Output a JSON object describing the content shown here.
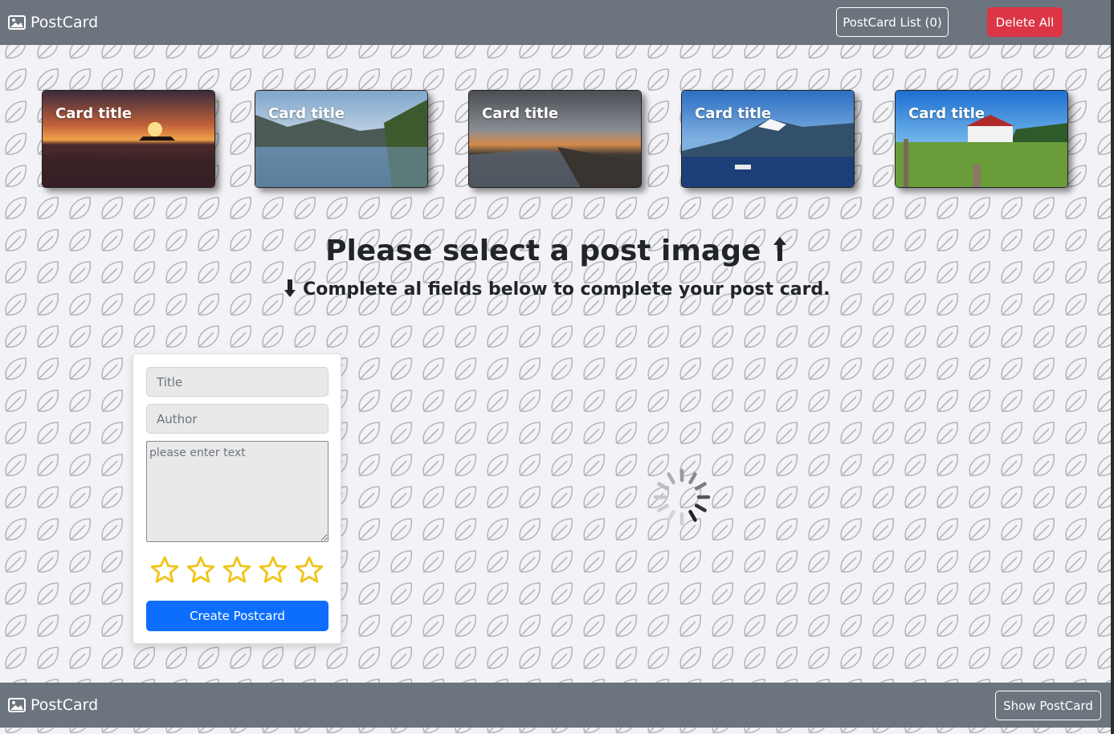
{
  "app": {
    "brand": "PostCard"
  },
  "header": {
    "list_button": "PostCard List (0)",
    "delete_button": "Delete All"
  },
  "cards": [
    {
      "title": "Card title",
      "scene": "sunset-sea"
    },
    {
      "title": "Card title",
      "scene": "fjord-reflection"
    },
    {
      "title": "Card title",
      "scene": "aerial-dusk"
    },
    {
      "title": "Card title",
      "scene": "snow-mountain-lake"
    },
    {
      "title": "Card title",
      "scene": "church-meadow"
    }
  ],
  "main": {
    "heading": "Please select a post image",
    "heading_icon": "arrow-up-icon",
    "subheading": "Complete al fields below to complete your post card.",
    "subheading_icon": "arrow-down-icon"
  },
  "form": {
    "title_placeholder": "Title",
    "author_placeholder": "Author",
    "text_placeholder": "please enter text",
    "rating": {
      "value": 0,
      "max": 5
    },
    "submit_label": "Create Postcard"
  },
  "footer": {
    "brand": "PostCard",
    "show_button": "Show PostCard"
  },
  "colors": {
    "navbar": "#6c757d",
    "danger": "#dc3545",
    "primary": "#0d6efd",
    "star": "#f0c419"
  }
}
